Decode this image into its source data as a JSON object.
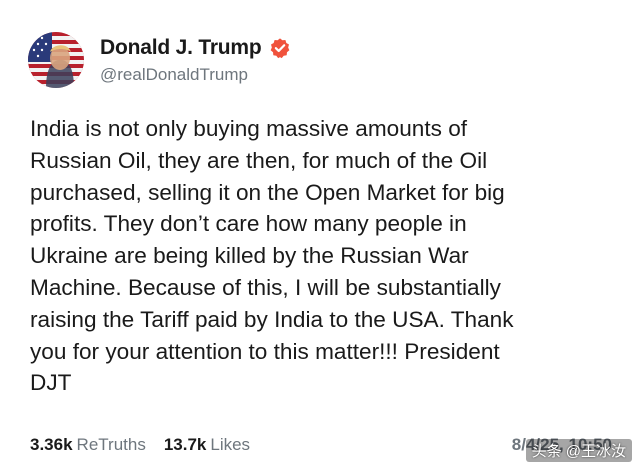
{
  "post": {
    "author": {
      "display_name": "Donald J. Trump",
      "handle": "@realDonaldTrump",
      "verified": true,
      "avatar_icon": "flag-portrait-avatar"
    },
    "text": "India is not only buying massive amounts of\nRussian Oil, they are then, for much of the Oil\npurchased, selling it on the Open Market for big\nprofits. They don’t care how many people in\nUkraine are being killed by the Russian War\nMachine. Because of this, I will be substantially\nraising the Tariff paid by India to the USA. Thank\nyou for your attention to this matter!!! President\nDJT",
    "stats": {
      "retruths_count": "3.36k",
      "retruths_label": "ReTruths",
      "likes_count": "13.7k",
      "likes_label": "Likes"
    },
    "timestamp": "8/4/25, 10:50"
  },
  "watermark": "头条 @王冰汝",
  "colors": {
    "verified_badge": "#f0523c",
    "muted_text": "#6e767d",
    "text": "#1a1a1a"
  }
}
